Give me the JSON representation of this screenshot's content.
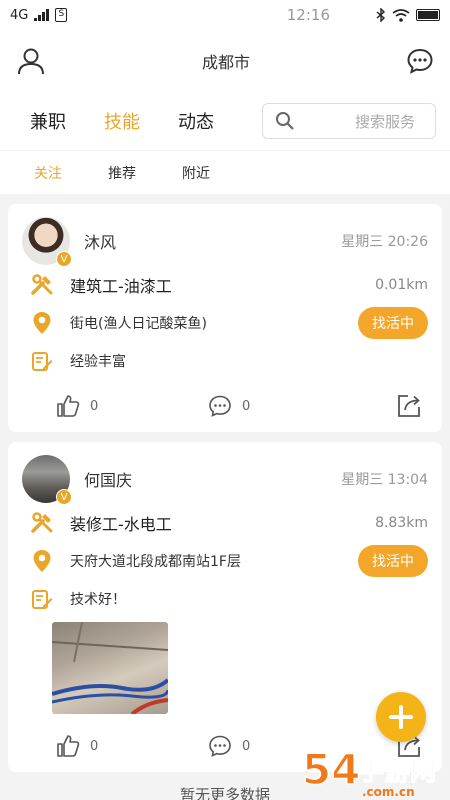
{
  "status_bar": {
    "network": "4G",
    "time": "12:16"
  },
  "header": {
    "city": "成都市"
  },
  "tabs": [
    {
      "label": "兼职"
    },
    {
      "label": "技能"
    },
    {
      "label": "动态"
    }
  ],
  "active_tab": "技能",
  "search": {
    "placeholder": "搜索服务"
  },
  "subtabs": [
    {
      "label": "关注"
    },
    {
      "label": "推荐"
    },
    {
      "label": "附近"
    }
  ],
  "posts": [
    {
      "name": "沐风",
      "badge": "V",
      "time": "星期三 20:26",
      "skill": "建筑工-油漆工",
      "distance": "0.01km",
      "location": "街电(渔人日记酸菜鱼)",
      "status": "找活中",
      "note": "经验丰富",
      "likes": "0",
      "comments": "0"
    },
    {
      "name": "何国庆",
      "badge": "V",
      "time": "星期三 13:04",
      "skill": "装修工-水电工",
      "distance": "8.83km",
      "location": "天府大道北段成都南站1F层",
      "status": "找活中",
      "note": "技术好！",
      "likes": "0",
      "comments": "0"
    }
  ],
  "footer": {
    "text": "暂无更多数据"
  },
  "watermark": {
    "text": "54手游网",
    "url": ".com.cn"
  },
  "colors": {
    "accent": "#e9a72a",
    "pill": "#f4a62a",
    "fab": "#f4b417"
  }
}
